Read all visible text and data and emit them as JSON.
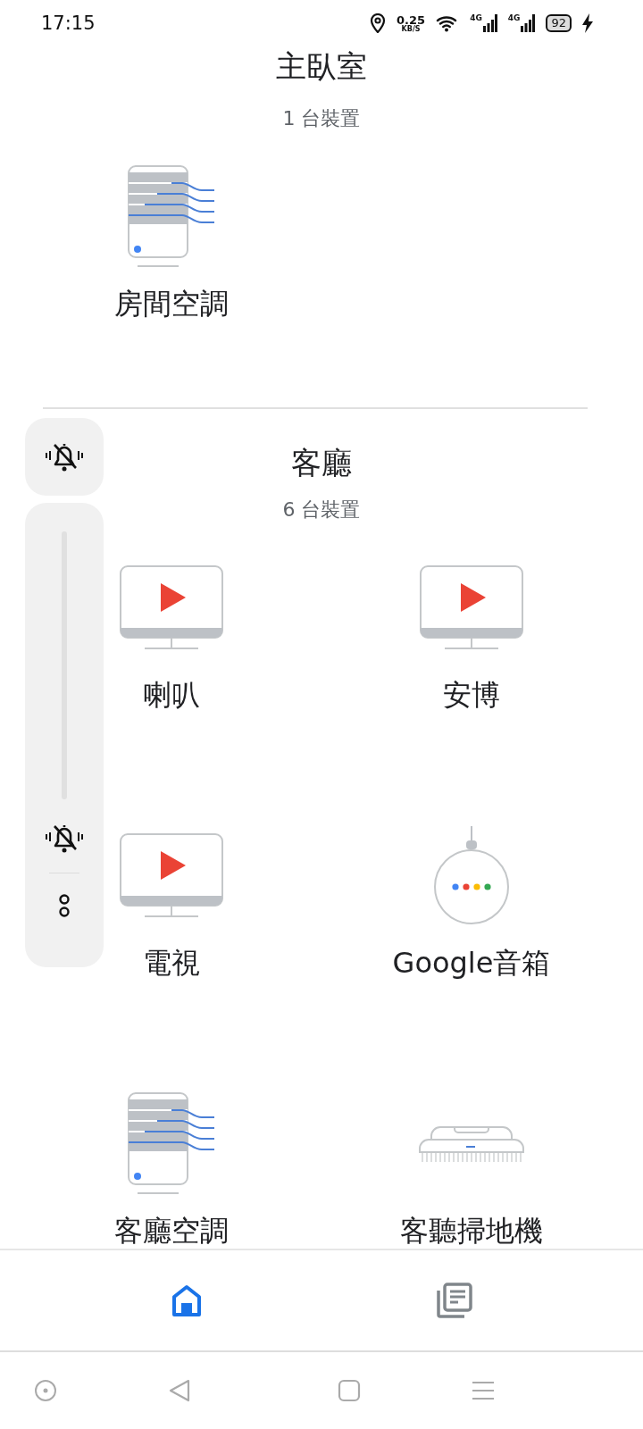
{
  "status_bar": {
    "time": "17:15",
    "net_speed": "0.25",
    "net_unit": "KB/S",
    "signals": [
      "4G",
      "4G"
    ],
    "battery": "92"
  },
  "rooms": [
    {
      "name": "主臥室",
      "count": "1 台裝置",
      "devices": [
        {
          "kind": "ac",
          "name": "房間空調"
        }
      ]
    },
    {
      "name": "客廳",
      "count": "6 台裝置",
      "devices": [
        {
          "kind": "tv",
          "name": "喇叭"
        },
        {
          "kind": "tv",
          "name": "安博"
        },
        {
          "kind": "tv",
          "name": "電視"
        },
        {
          "kind": "speaker",
          "name": "Google音箱"
        },
        {
          "kind": "ac",
          "name": "客廳空調"
        },
        {
          "kind": "vacuum",
          "name": "客聽掃地機"
        }
      ]
    }
  ],
  "volume_panel": {
    "level": 0
  },
  "bottom_nav": [
    {
      "kind": "home",
      "selected": true
    },
    {
      "kind": "feed",
      "selected": false
    }
  ]
}
